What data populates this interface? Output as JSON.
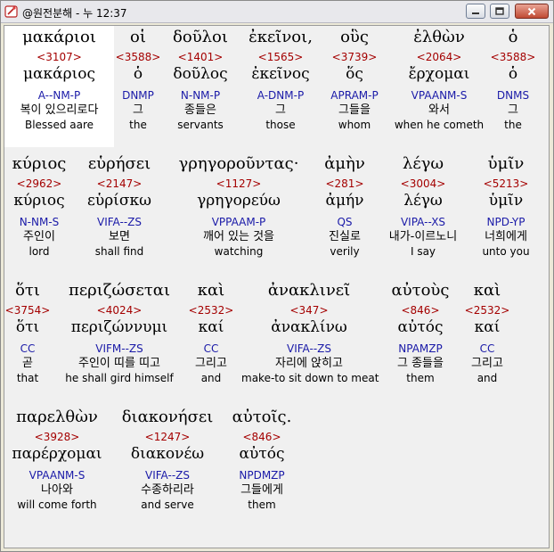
{
  "window": {
    "title": "@원전분해 - 누 12:37"
  },
  "verse": [
    {
      "greek": "μακάριοι",
      "strong": "<3107>",
      "lemma": "μακάριος",
      "parse": "A--NM-P",
      "korean": "복이 있으리로다",
      "english": "Blessed aare",
      "selected": true
    },
    {
      "greek": "οἱ",
      "strong": "<3588>",
      "lemma": "ὁ",
      "parse": "DNMP",
      "korean": "그",
      "english": "the"
    },
    {
      "greek": "δοῦλοι",
      "strong": "<1401>",
      "lemma": "δοῦλος",
      "parse": "N-NM-P",
      "korean": "종들은",
      "english": "servants"
    },
    {
      "greek": "ἐκεῖνοι,",
      "strong": "<1565>",
      "lemma": "ἐκεῖνος",
      "parse": "A-DNM-P",
      "korean": "그",
      "english": "those"
    },
    {
      "greek": "οὓς",
      "strong": "<3739>",
      "lemma": "ὅς",
      "parse": "APRAM-P",
      "korean": "그들을",
      "english": "whom"
    },
    {
      "greek": "ἐλθὼν",
      "strong": "<2064>",
      "lemma": "ἔρχομαι",
      "parse": "VPAANM-S",
      "korean": "와서",
      "english": "when he cometh"
    },
    {
      "greek": "ὁ",
      "strong": "<3588>",
      "lemma": "ὁ",
      "parse": "DNMS",
      "korean": "그",
      "english": "the"
    },
    {
      "greek": "κύριος",
      "strong": "<2962>",
      "lemma": "κύριος",
      "parse": "N-NM-S",
      "korean": "주인이",
      "english": "lord"
    },
    {
      "greek": "εὑρήσει",
      "strong": "<2147>",
      "lemma": "εὑρίσκω",
      "parse": "VIFA--ZS",
      "korean": "보면",
      "english": "shall find"
    },
    {
      "greek": "γρηγοροῦντας·",
      "strong": "<1127>",
      "lemma": "γρηγορεύω",
      "parse": "VPPAAM-P",
      "korean": "깨어 있는 것을",
      "english": "watching"
    },
    {
      "greek": "ἀμὴν",
      "strong": "<281>",
      "lemma": "ἀμήν",
      "parse": "QS",
      "korean": "진실로",
      "english": "verily"
    },
    {
      "greek": "λέγω",
      "strong": "<3004>",
      "lemma": "λέγω",
      "parse": "VIPA--XS",
      "korean": "내가-이르노니",
      "english": "I say"
    },
    {
      "greek": "ὑμῖν",
      "strong": "<5213>",
      "lemma": "ὑμῖν",
      "parse": "NPD-YP",
      "korean": "너희에게",
      "english": "unto you"
    },
    {
      "greek": "ὅτι",
      "strong": "<3754>",
      "lemma": "ὅτι",
      "parse": "CC",
      "korean": "곧",
      "english": "that"
    },
    {
      "greek": "περιζώσεται",
      "strong": "<4024>",
      "lemma": "περιζώννυμι",
      "parse": "VIFM--ZS",
      "korean": "주인이 띠를 띠고",
      "english": "he shall gird himself"
    },
    {
      "greek": "καὶ",
      "strong": "<2532>",
      "lemma": "καί",
      "parse": "CC",
      "korean": "그리고",
      "english": "and"
    },
    {
      "greek": "ἀνακλινεῖ",
      "strong": "<347>",
      "lemma": "ἀνακλίνω",
      "parse": "VIFA--ZS",
      "korean": "자리에 앉히고",
      "english": "make-to sit down to meat"
    },
    {
      "greek": "αὐτοὺς",
      "strong": "<846>",
      "lemma": "αὐτός",
      "parse": "NPAMZP",
      "korean": "그 종들을",
      "english": "them"
    },
    {
      "greek": "καὶ",
      "strong": "<2532>",
      "lemma": "καί",
      "parse": "CC",
      "korean": "그리고",
      "english": "and"
    },
    {
      "greek": "παρελθὼν",
      "strong": "<3928>",
      "lemma": "παρέρχομαι",
      "parse": "VPAANM-S",
      "korean": "나아와",
      "english": "will come forth"
    },
    {
      "greek": "διακονήσει",
      "strong": "<1247>",
      "lemma": "διακονέω",
      "parse": "VIFA--ZS",
      "korean": "수종하리라",
      "english": "and serve"
    },
    {
      "greek": "αὐτοῖς.",
      "strong": "<846>",
      "lemma": "αὐτός",
      "parse": "NPDMZP",
      "korean": "그들에게",
      "english": "them"
    }
  ]
}
